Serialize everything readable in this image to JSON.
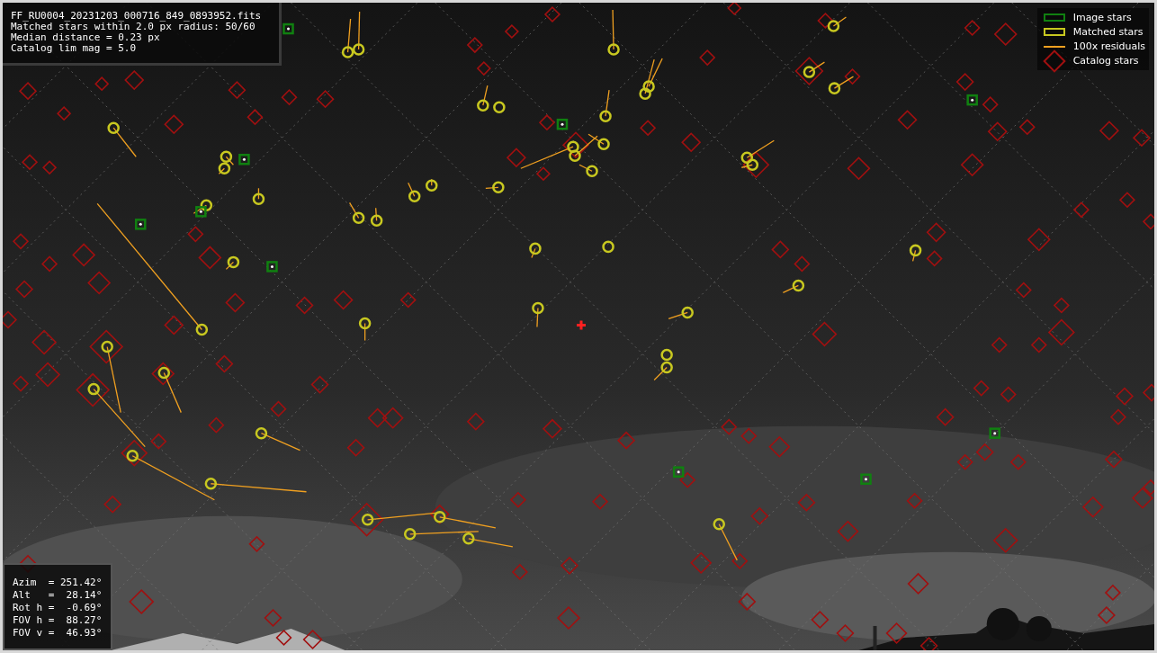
{
  "info_box": {
    "lines": [
      "FF_RU0004_20231203_000716_849_0893952.fits",
      "Matched stars within 2.0 px radius: 50/60",
      "Median distance = 0.23 px",
      "Catalog lim mag = 5.0"
    ]
  },
  "legend": [
    {
      "kind": "box",
      "color": "#108010",
      "label": "Image stars"
    },
    {
      "kind": "box",
      "color": "#c8c820",
      "label": "Matched stars"
    },
    {
      "kind": "line",
      "color": "#f0a020",
      "label": "100x residuals"
    },
    {
      "kind": "diamond",
      "color": "#a01010",
      "label": "Catalog stars"
    }
  ],
  "pointing_box": {
    "lines": [
      "Azim  = 251.42°",
      "Alt   =  28.14°",
      "Rot h =  -0.69°",
      "FOV h =  88.27°",
      "FOV v =  46.93°"
    ]
  }
}
